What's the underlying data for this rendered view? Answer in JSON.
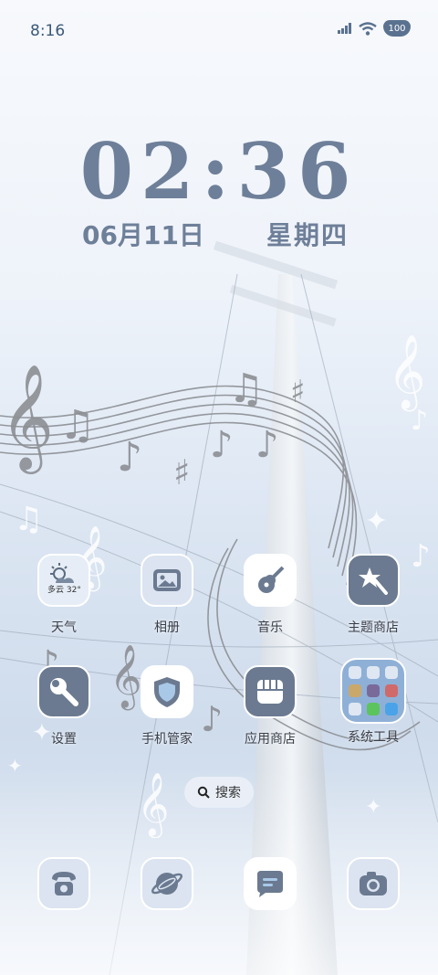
{
  "status_bar": {
    "time": "8:16",
    "battery": "100",
    "icons": [
      "signal-icon",
      "wifi-icon",
      "battery-icon"
    ]
  },
  "clock": {
    "time": "02:36",
    "date": "06月11日",
    "weekday": "星期四"
  },
  "weather_widget": {
    "condition": "多云",
    "temperature": "32°"
  },
  "apps": [
    {
      "label": "天气",
      "icon": "weather-icon"
    },
    {
      "label": "相册",
      "icon": "gallery-icon"
    },
    {
      "label": "音乐",
      "icon": "guitar-icon"
    },
    {
      "label": "主题商店",
      "icon": "theme-store-icon"
    },
    {
      "label": "设置",
      "icon": "wrench-icon"
    },
    {
      "label": "手机管家",
      "icon": "shield-icon"
    },
    {
      "label": "应用商店",
      "icon": "app-store-icon"
    },
    {
      "label": "系统工具",
      "icon": "folder-icon"
    }
  ],
  "search": {
    "label": "搜索"
  },
  "dock": [
    {
      "icon": "phone-icon"
    },
    {
      "icon": "browser-icon"
    },
    {
      "icon": "messages-icon"
    },
    {
      "icon": "camera-icon"
    }
  ],
  "colors": {
    "icon_fill": "#6b7a90",
    "tile_bg": "#dbe4f0",
    "accent": "#6e7f99"
  }
}
